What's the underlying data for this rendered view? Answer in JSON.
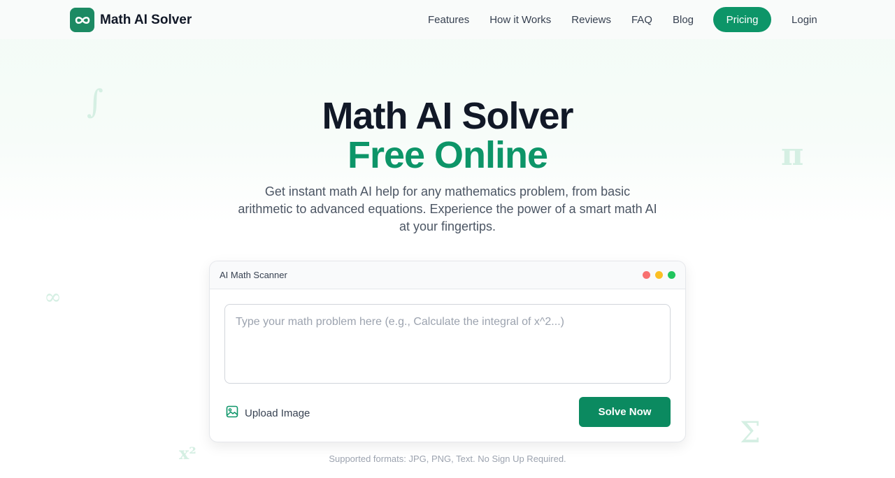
{
  "nav": {
    "brand": "Math AI Solver",
    "links": [
      "Features",
      "How it Works",
      "Reviews",
      "FAQ",
      "Blog"
    ],
    "pricing_label": "Pricing",
    "login_label": "Login"
  },
  "decorations": {
    "integral": "∫",
    "pi": "π",
    "infinity": "∞",
    "sigma": "Σ",
    "x_squared": "x²"
  },
  "hero": {
    "title_line1": "Math AI Solver",
    "title_line2": "Free Online",
    "description": "Get instant math AI help for any mathematics problem, from basic arithmetic to advanced equations. Experience the power of a smart math AI at your fingertips."
  },
  "scanner": {
    "title": "AI Math Scanner",
    "input_placeholder": "Type your math problem here (e.g., Calculate the integral of x^2...)",
    "input_value": "",
    "upload_label": "Upload Image",
    "solve_label": "Solve Now",
    "window_dot_colors": [
      "#f87171",
      "#fbbf24",
      "#22c55e"
    ]
  },
  "footnote": "Supported formats: JPG, PNG, Text. No Sign Up Required.",
  "colors": {
    "brand": "#0d9568",
    "heading": "#111827"
  },
  "icons": {
    "logo": "infinity-icon",
    "upload": "image-icon"
  }
}
